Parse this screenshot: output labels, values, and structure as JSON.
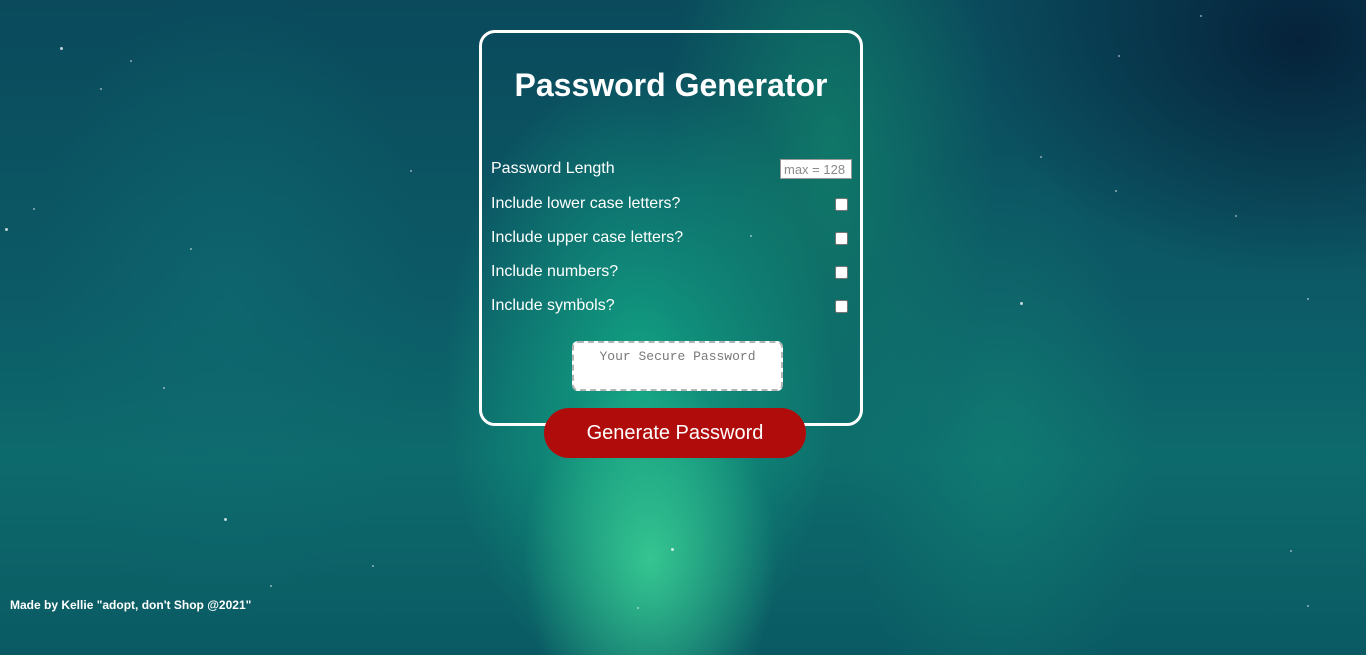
{
  "app": {
    "title": "Password Generator"
  },
  "form": {
    "length_label": "Password Length",
    "length_placeholder": "max = 128",
    "length_value": "",
    "options": [
      {
        "label": "Include lower case letters?",
        "checked": false
      },
      {
        "label": "Include upper case letters?",
        "checked": false
      },
      {
        "label": "Include numbers?",
        "checked": false
      },
      {
        "label": "Include symbols?",
        "checked": false
      }
    ]
  },
  "output": {
    "placeholder": "Your Secure Password",
    "value": ""
  },
  "actions": {
    "generate_label": "Generate Password"
  },
  "footer": {
    "text": "Made by Kellie \"adopt, don't Shop @2021\""
  },
  "colors": {
    "button": "#b00c0c",
    "card_border": "#ffffff",
    "text": "#ffffff"
  }
}
